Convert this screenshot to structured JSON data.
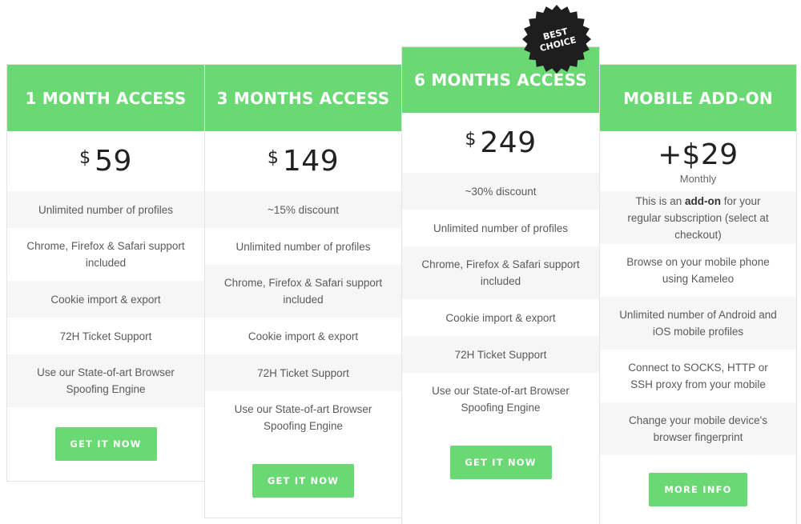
{
  "plans": [
    {
      "title": "1 MONTH ACCESS",
      "currency": "$",
      "price": "59",
      "features": [
        "Unlimited number of profiles",
        "Chrome, Firefox & Safari support included",
        "Cookie import & export",
        "72H Ticket Support",
        "Use our State-of-art Browser Spoofing Engine"
      ],
      "button": "GET IT NOW"
    },
    {
      "title": "3 MONTHS ACCESS",
      "currency": "$",
      "price": "149",
      "features": [
        "~15% discount",
        "Unlimited number of profiles",
        "Chrome, Firefox & Safari support included",
        "Cookie import & export",
        "72H Ticket Support",
        "Use our State-of-art Browser Spoofing Engine"
      ],
      "button": "GET IT NOW"
    },
    {
      "title": "6 MONTHS ACCESS",
      "currency": "$",
      "price": "249",
      "features": [
        "~30% discount",
        "Unlimited number of profiles",
        "Chrome, Firefox & Safari support included",
        "Cookie import & export",
        "72H Ticket Support",
        "Use our State-of-art Browser Spoofing Engine"
      ],
      "button": "GET IT NOW",
      "badge": [
        "BEST",
        "CHOICE"
      ]
    },
    {
      "title": "MOBILE ADD-ON",
      "plus": "+",
      "currency": "$",
      "price": "29",
      "period": "Monthly",
      "features": [
        {
          "pre": "This is an ",
          "bold": "add-on",
          "post": " for your regular subscription (select at checkout)"
        },
        "Browse on your mobile phone using Kameleo",
        "Unlimited number of Android and iOS mobile profiles",
        "Connect to SOCKS, HTTP or SSH proxy from your mobile",
        "Change your mobile device's browser fingerprint"
      ],
      "button": "MORE INFO"
    }
  ],
  "colors": {
    "accent": "#6ad873",
    "badge": "#1e1e1e",
    "alt_row": "#f6f6f6"
  }
}
